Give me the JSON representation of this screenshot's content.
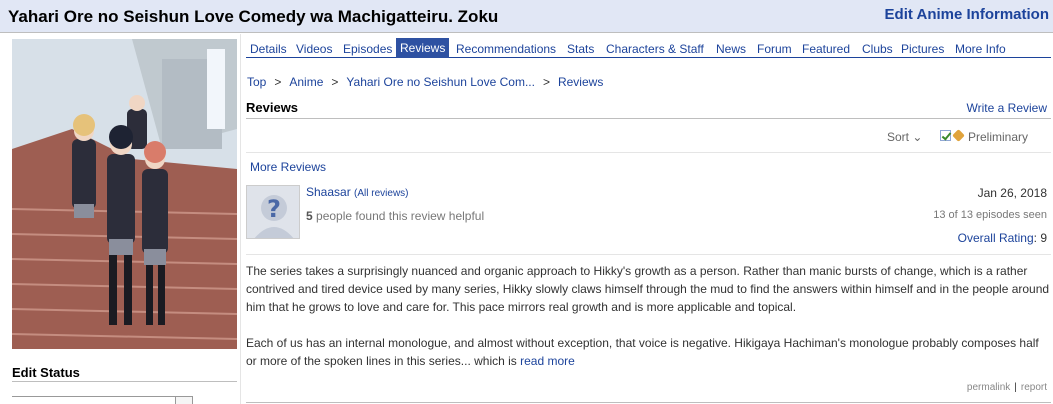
{
  "header": {
    "title": "Yahari Ore no Seishun Love Comedy wa Machigatteiru. Zoku",
    "edit_link": "Edit Anime Information"
  },
  "sidebar": {
    "edit_status": "Edit Status"
  },
  "nav": {
    "tabs": [
      {
        "label": "Details"
      },
      {
        "label": "Videos"
      },
      {
        "label": "Episodes"
      },
      {
        "label": "Reviews",
        "active": true
      },
      {
        "label": "Recommendations"
      },
      {
        "label": "Stats"
      },
      {
        "label": "Characters & Staff"
      },
      {
        "label": "News"
      },
      {
        "label": "Forum"
      },
      {
        "label": "Featured"
      },
      {
        "label": "Clubs"
      },
      {
        "label": "Pictures"
      },
      {
        "label": "More Info"
      }
    ]
  },
  "breadcrumb": {
    "items": [
      "Top",
      "Anime",
      "Yahari Ore no Seishun Love Com...",
      "Reviews"
    ],
    "separator": ">"
  },
  "reviews": {
    "heading": "Reviews",
    "write_review": "Write a Review",
    "sort_label": "Sort",
    "sort_caret": "⌄",
    "preliminary_label": "Preliminary",
    "more_reviews": "More Reviews"
  },
  "review": {
    "author": "Shaasar",
    "all_reviews": "(All reviews)",
    "helpful_count": "5",
    "helpful_text": "people found this review helpful",
    "date": "Jan 26, 2018",
    "episodes_seen": "13 of 13 episodes seen",
    "rating_label": "Overall Rating",
    "rating_value": "9",
    "paragraph1": "The series takes a surprisingly nuanced and organic approach to Hikky's growth as a person. Rather than manic bursts of change, which is a rather contrived and tired device used by many series, Hikky slowly claws himself through the mud to find the answers within himself and in the people around him that he grows to love and care for. This pace mirrors real growth and is more applicable and topical.",
    "paragraph2": "Each of us has an internal monologue, and almost without exception, that voice is negative. Hikigaya Hachiman's monologue probably composes half or more of the spoken lines in this series... which is",
    "read_more": "read more",
    "permalink": "permalink",
    "report": "report"
  },
  "colors": {
    "link": "#1c439b",
    "active_tab": "#2e51a2",
    "header_bg": "#e1e7f5"
  }
}
